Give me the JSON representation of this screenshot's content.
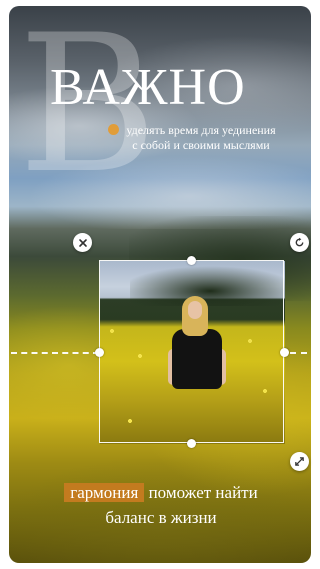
{
  "story": {
    "big_letter": "В",
    "headline": "ВАЖНО",
    "subtext_line1": "уделять время для уединения",
    "subtext_line2": "с собой и своими мыслями",
    "caption_highlight": "гармония",
    "caption_rest": " поможет найти",
    "caption_line2": "баланс в жизни"
  },
  "controls": {
    "delete_icon": "close-icon",
    "rotate_icon": "rotate-icon",
    "resize_icon": "resize-icon"
  },
  "colors": {
    "highlight": "#c37b1f",
    "accent_dot": "#e79a2a"
  }
}
